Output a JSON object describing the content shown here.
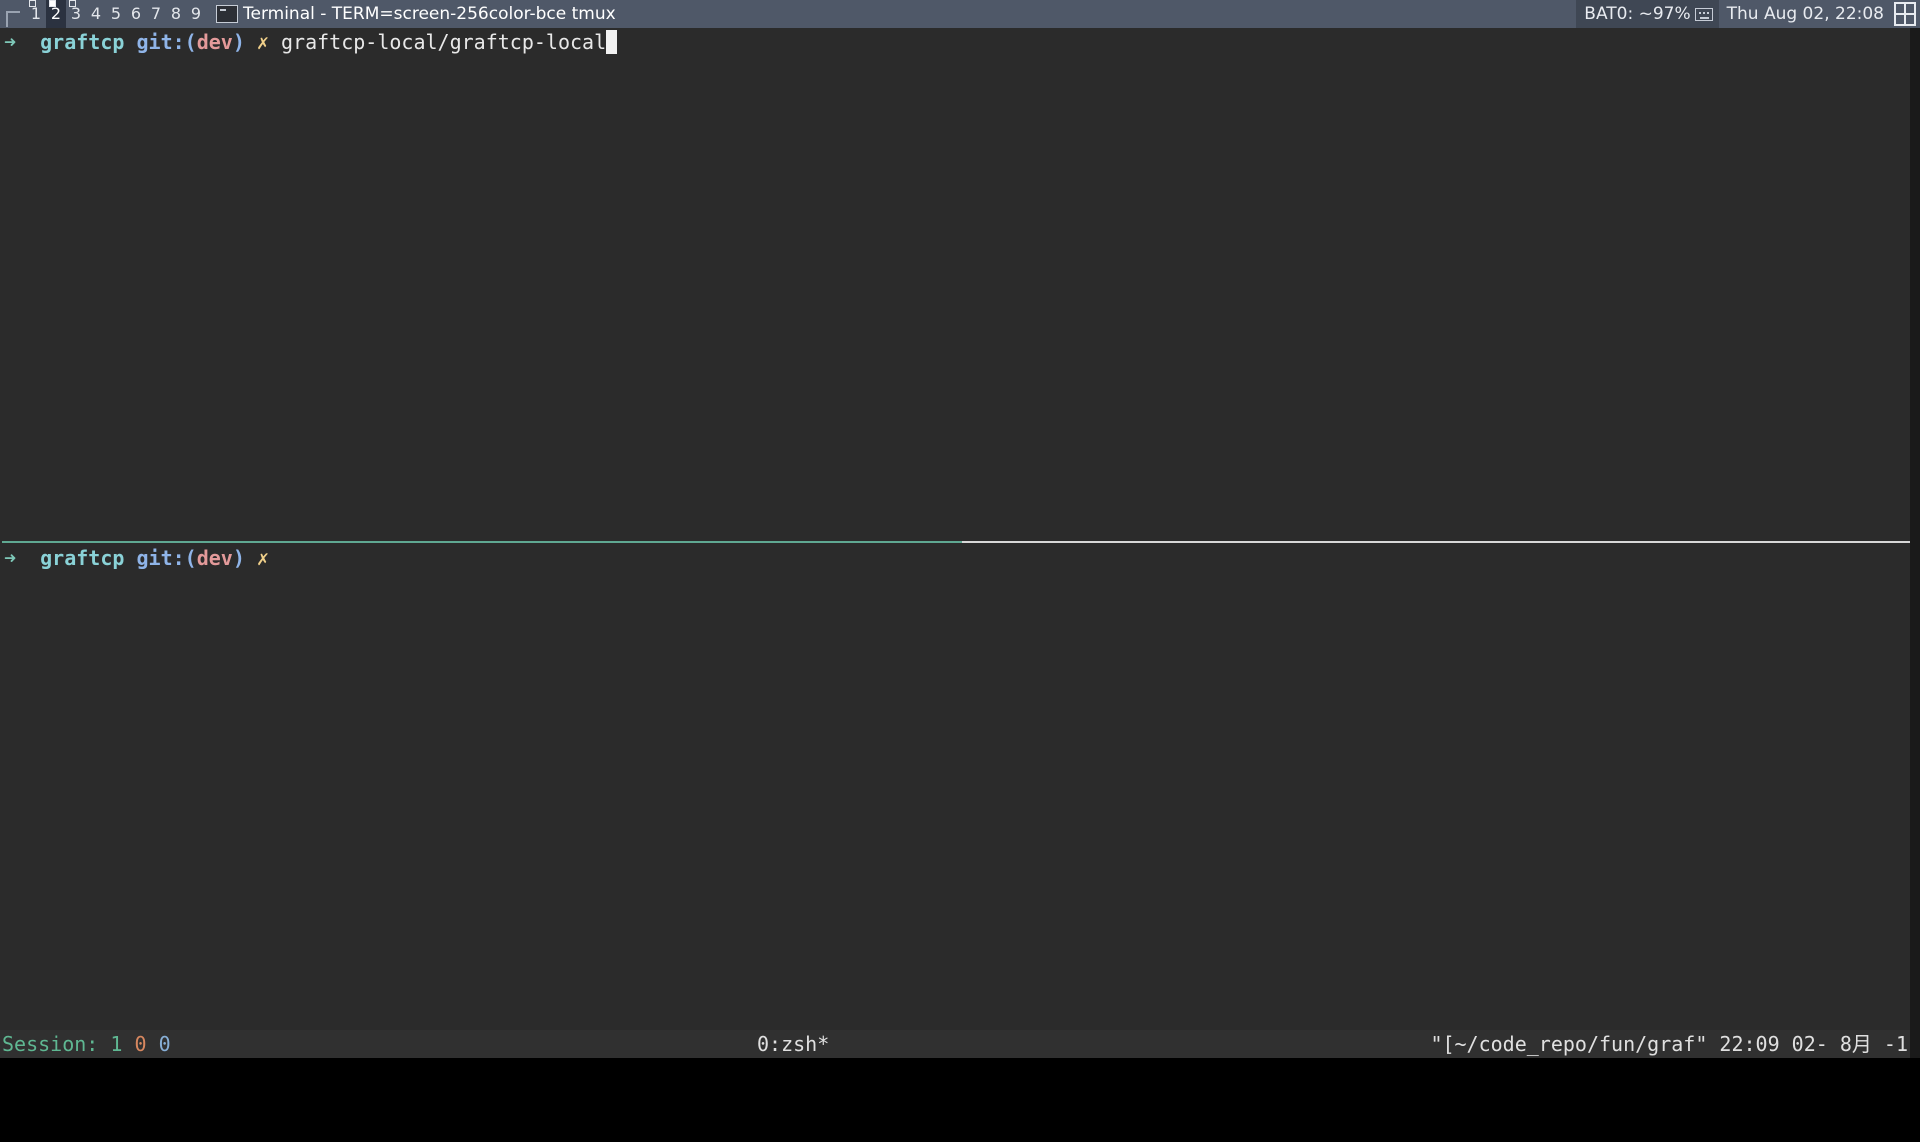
{
  "panel": {
    "workspaces": [
      "1",
      "2",
      "3",
      "4",
      "5",
      "6",
      "7",
      "8",
      "9"
    ],
    "active_workspace_index": 1,
    "window_title": "Terminal - TERM=screen-256color-bce tmux",
    "battery": "BAT0: ~97%",
    "clock": "Thu Aug 02, 22:08"
  },
  "panes": {
    "top": {
      "prompt_arrow": "➜",
      "dir": "graftcp",
      "git_label": "git:(",
      "branch": "dev",
      "git_close": ")",
      "dirty_mark": "✗",
      "command": "graftcp-local/graftcp-local"
    },
    "bottom": {
      "prompt_arrow": "➜",
      "dir": "graftcp",
      "git_label": "git:(",
      "branch": "dev",
      "git_close": ")",
      "dirty_mark": "✗",
      "command": ""
    }
  },
  "tmux_status": {
    "session_label": "Session:",
    "session_num": "1",
    "window_num": "0",
    "pane_num": "0",
    "window_list": "0:zsh*",
    "right_text": "\"[~/code_repo/fun/graf\" 22:09 02- 8月 -1"
  },
  "colors": {
    "panel_bg": "#4f5868",
    "terminal_bg": "#2b2b2b",
    "prompt_dir": "#8ad2d7",
    "git_label": "#8fb4e8",
    "branch": "#e39a9a",
    "status_green": "#5fb792"
  },
  "icons": {
    "menu": "panel-menu-icon",
    "task": "terminal-icon",
    "keyboard": "keyboard-icon",
    "grid": "grid-layout-icon"
  }
}
